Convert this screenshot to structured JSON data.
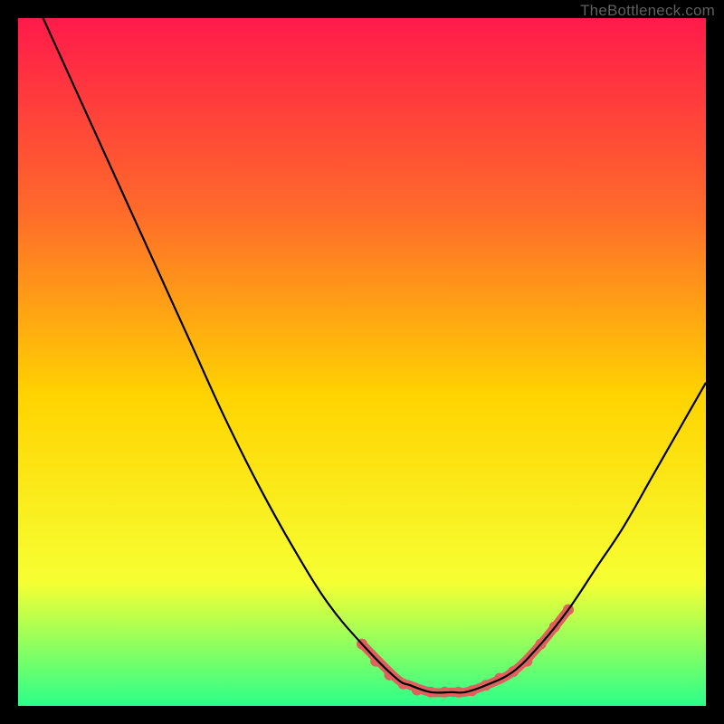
{
  "attribution": "TheBottleneck.com",
  "chart_data": {
    "type": "line",
    "title": "",
    "xlabel": "",
    "ylabel": "",
    "xlim": [
      0,
      100
    ],
    "ylim": [
      0,
      100
    ],
    "background_gradient": {
      "top": "#ff1a4a",
      "mid_upper": "#ff6a2a",
      "mid": "#ffd400",
      "mid_lower": "#f6ff33",
      "bottom": "#2cff8a"
    },
    "curve": {
      "name": "bottleneck-curve",
      "x": [
        0,
        5,
        10,
        15,
        20,
        25,
        30,
        35,
        40,
        45,
        50,
        55,
        57,
        60,
        63,
        65,
        68,
        72,
        76,
        80,
        84,
        88,
        92,
        96,
        100
      ],
      "y": [
        108,
        97,
        86,
        75,
        64,
        53,
        42,
        32,
        23,
        15,
        9,
        4,
        3,
        2,
        2,
        2,
        3,
        5,
        9,
        14,
        20,
        26,
        33,
        40,
        47
      ]
    },
    "highlight_segments": [
      {
        "x": [
          50,
          55,
          57,
          60,
          63,
          65,
          68,
          72,
          76,
          80
        ],
        "y": [
          9,
          4,
          3,
          2,
          2,
          2,
          3,
          5,
          9,
          14
        ]
      }
    ],
    "highlight_dots": {
      "x": [
        50,
        52,
        54,
        56,
        58,
        60,
        62,
        64,
        66,
        68,
        70,
        72,
        74,
        76,
        78,
        80
      ],
      "y": [
        9,
        6.5,
        4.5,
        3.2,
        2.3,
        2,
        2,
        2,
        2.2,
        3,
        4,
        5,
        6.5,
        9,
        11.5,
        14
      ],
      "color": "#e06060",
      "radius": 6
    }
  }
}
